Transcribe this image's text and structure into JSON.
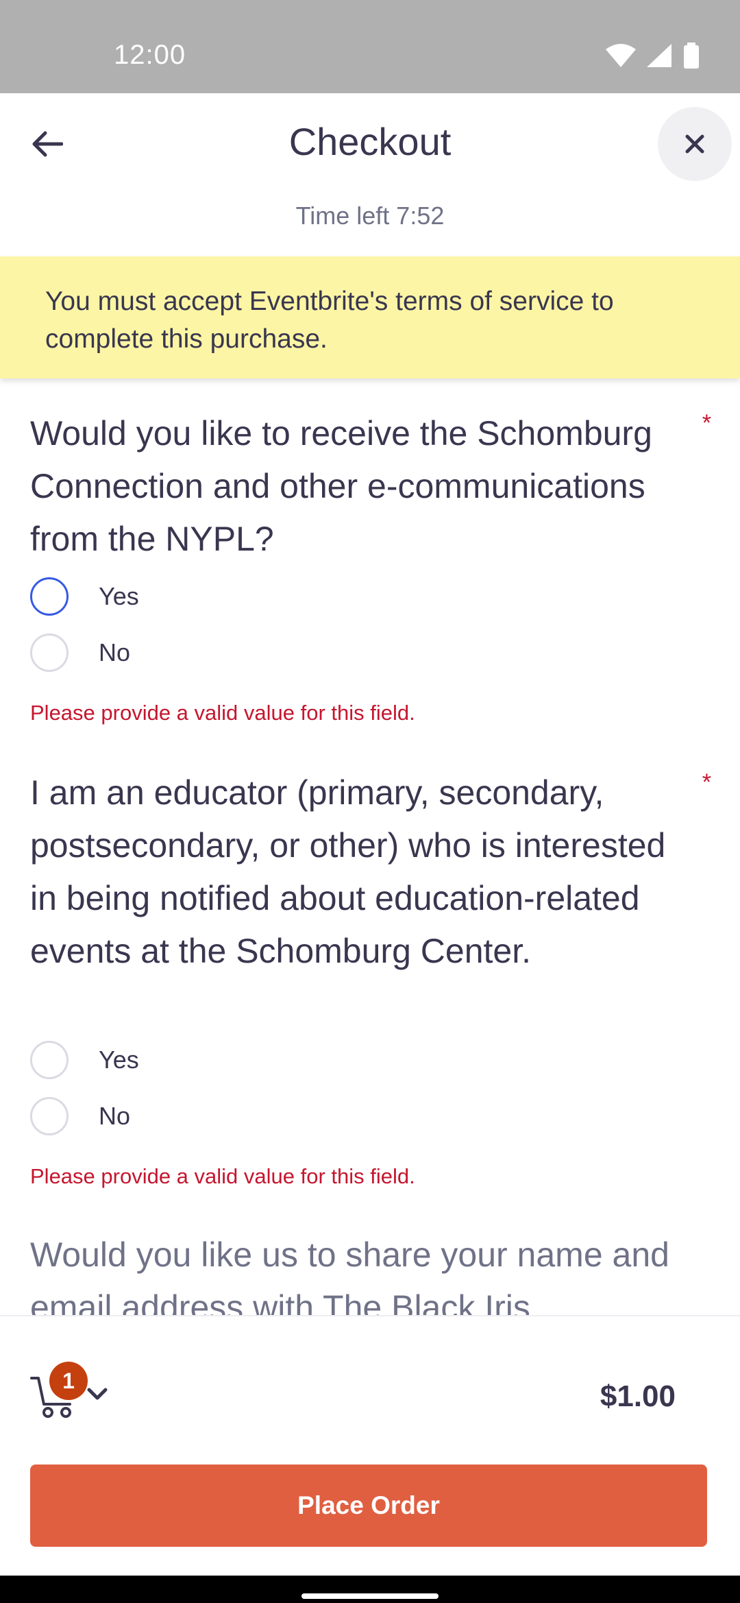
{
  "status_bar": {
    "time": "12:00",
    "icons": [
      "wifi-icon",
      "signal-icon",
      "battery-icon"
    ]
  },
  "header": {
    "title": "Checkout",
    "time_left": "Time left 7:52"
  },
  "banner": {
    "text": "You must accept Eventbrite's terms of service to complete this purchase."
  },
  "questions": [
    {
      "text": "Would you like to receive the Schomburg Connection and other e-communications from the NYPL?",
      "required_mark": "*",
      "options": [
        {
          "label": "Yes",
          "selected": false
        },
        {
          "label": "No",
          "selected": false
        }
      ],
      "error": "Please provide a valid value for this field."
    },
    {
      "text": "I am an educator (primary, secondary, postsecondary, or other) who is interested in being notified about education-related events at the Schomburg Center.",
      "required_mark": "*",
      "options": [
        {
          "label": "Yes",
          "selected": false
        },
        {
          "label": "No",
          "selected": false
        }
      ],
      "error": "Please provide a valid value for this field."
    },
    {
      "text": "Would you like us to share your name and email address with The Black Iris"
    }
  ],
  "cart": {
    "count": "1",
    "total": "$1.00"
  },
  "actions": {
    "place_order": "Place Order"
  },
  "colors": {
    "accent": "#e05f41",
    "error": "#c5162e",
    "banner": "#fbf5a5",
    "focus": "#3659e3"
  }
}
